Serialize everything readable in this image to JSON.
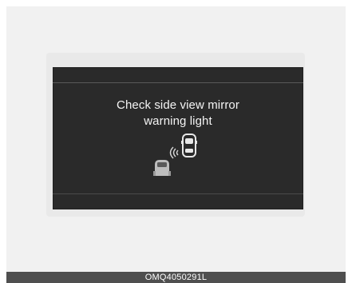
{
  "display": {
    "message_line1": "Check side view mirror",
    "message_line2": "warning light",
    "icon": "blind-spot-warning-icon"
  },
  "caption": {
    "code": "OMQ4050291L"
  },
  "colors": {
    "display_background": "#2a2a2a",
    "display_text": "#f4f4f4",
    "caption_bar": "#4f4f4f"
  }
}
